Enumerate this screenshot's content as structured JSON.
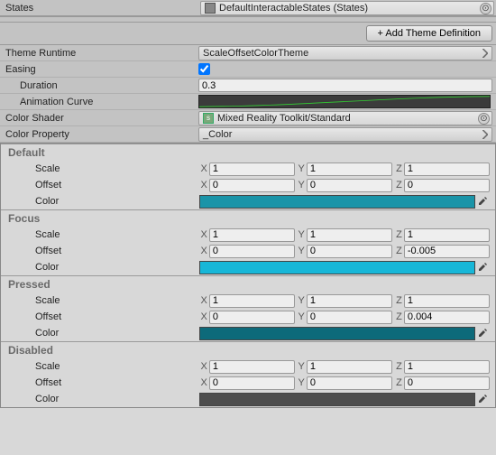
{
  "top": {
    "states_label": "States",
    "states_value": "DefaultInteractableStates (States)"
  },
  "toolbar": {
    "add_theme": "+ Add Theme Definition"
  },
  "settings": {
    "theme_runtime_label": "Theme Runtime",
    "theme_runtime_value": "ScaleOffsetColorTheme",
    "easing_label": "Easing",
    "easing_checked": true,
    "duration_label": "Duration",
    "duration_value": "0.3",
    "anim_curve_label": "Animation Curve",
    "color_shader_label": "Color Shader",
    "color_shader_value": "Mixed Reality Toolkit/Standard",
    "color_property_label": "Color Property",
    "color_property_value": "_Color"
  },
  "states": [
    {
      "name": "Default",
      "scale_label": "Scale",
      "offset_label": "Offset",
      "color_label": "Color",
      "scale": {
        "x": "1",
        "y": "1",
        "z": "1"
      },
      "offset": {
        "x": "0",
        "y": "0",
        "z": "0"
      },
      "color": "#1a94a8"
    },
    {
      "name": "Focus",
      "scale_label": "Scale",
      "offset_label": "Offset",
      "color_label": "Color",
      "scale": {
        "x": "1",
        "y": "1",
        "z": "1"
      },
      "offset": {
        "x": "0",
        "y": "0",
        "z": "-0.005"
      },
      "color": "#17b7d8"
    },
    {
      "name": "Pressed",
      "scale_label": "Scale",
      "offset_label": "Offset",
      "color_label": "Color",
      "scale": {
        "x": "1",
        "y": "1",
        "z": "1"
      },
      "offset": {
        "x": "0",
        "y": "0",
        "z": "0.004"
      },
      "color": "#0d6a7a"
    },
    {
      "name": "Disabled",
      "scale_label": "Scale",
      "offset_label": "Offset",
      "color_label": "Color",
      "scale": {
        "x": "1",
        "y": "1",
        "z": "1"
      },
      "offset": {
        "x": "0",
        "y": "0",
        "z": "0"
      },
      "color": "#4d4d4d"
    }
  ],
  "axis": {
    "x": "X",
    "y": "Y",
    "z": "Z"
  }
}
